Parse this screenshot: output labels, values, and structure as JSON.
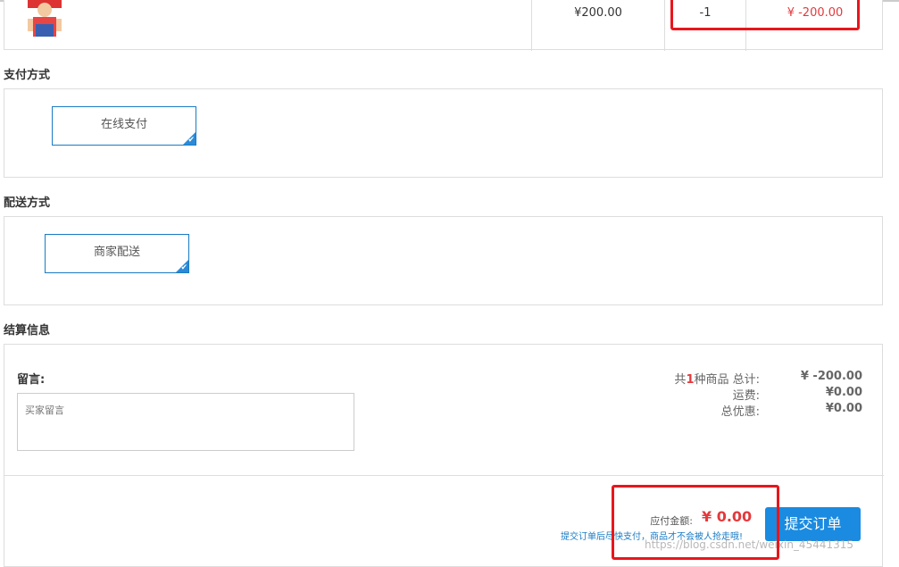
{
  "product_row": {
    "unit_price": "¥200.00",
    "quantity": "-1",
    "subtotal": "¥ -200.00"
  },
  "payment": {
    "title": "支付方式",
    "option_label": "在线支付"
  },
  "delivery": {
    "title": "配送方式",
    "option_label": "商家配送"
  },
  "settlement": {
    "title": "结算信息",
    "message_label": "留言:",
    "message_placeholder": "买家留言",
    "summary": {
      "count_prefix": "共",
      "count_value": "1",
      "count_suffix": "种商品 总计:",
      "total_value": "¥ -200.00",
      "shipping_label": "运费:",
      "shipping_value": "¥0.00",
      "discount_label": "总优惠:",
      "discount_value": "¥0.00"
    }
  },
  "footer": {
    "payable_label": "应付金额:",
    "payable_value": "¥ 0.00",
    "notice": "提交订单后尽快支付，商品才不会被人抢走哦!",
    "submit_label": "提交订单",
    "watermark": "https://blog.csdn.net/weixin_45441315"
  },
  "colors": {
    "accent_blue": "#1a8be0",
    "price_red": "#e4393c",
    "highlight_frame": "#e8161c"
  }
}
